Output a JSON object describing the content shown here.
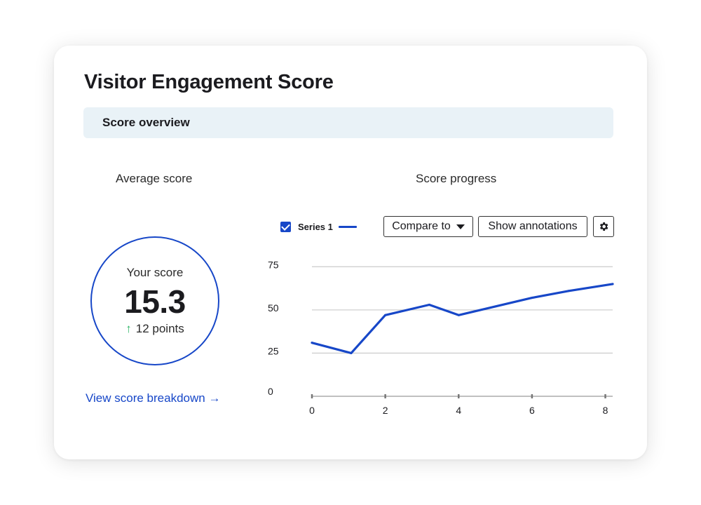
{
  "card": {
    "title": "Visitor Engagement Score",
    "section_label": "Score overview"
  },
  "average": {
    "heading": "Average score",
    "your_score_label": "Your score",
    "score_value": "15.3",
    "delta_arrow": "↑",
    "delta_text": "12 points",
    "breakdown_link": "View score breakdown →"
  },
  "progress": {
    "heading": "Score progress",
    "series_label": "Series 1",
    "compare_label": "Compare to",
    "annotations_label": "Show annotations",
    "settings_icon": "gear-icon"
  },
  "colors": {
    "accent": "#1747c8",
    "delta_up": "#2db566",
    "section_bg": "#e9f2f7"
  },
  "chart_data": {
    "type": "line",
    "series": [
      {
        "name": "Series 1",
        "x": [
          0,
          1.07,
          2,
          3.2,
          4,
          5,
          6,
          7,
          8.2
        ],
        "y": [
          31,
          25,
          47,
          53,
          47,
          52,
          57,
          61,
          65
        ]
      }
    ],
    "x_ticks": [
      0,
      2,
      4,
      6,
      8
    ],
    "y_ticks": [
      0,
      25,
      50,
      75
    ],
    "xlim": [
      0,
      8.2
    ],
    "ylim": [
      0,
      80
    ],
    "grid": true,
    "legend": "top-left"
  }
}
